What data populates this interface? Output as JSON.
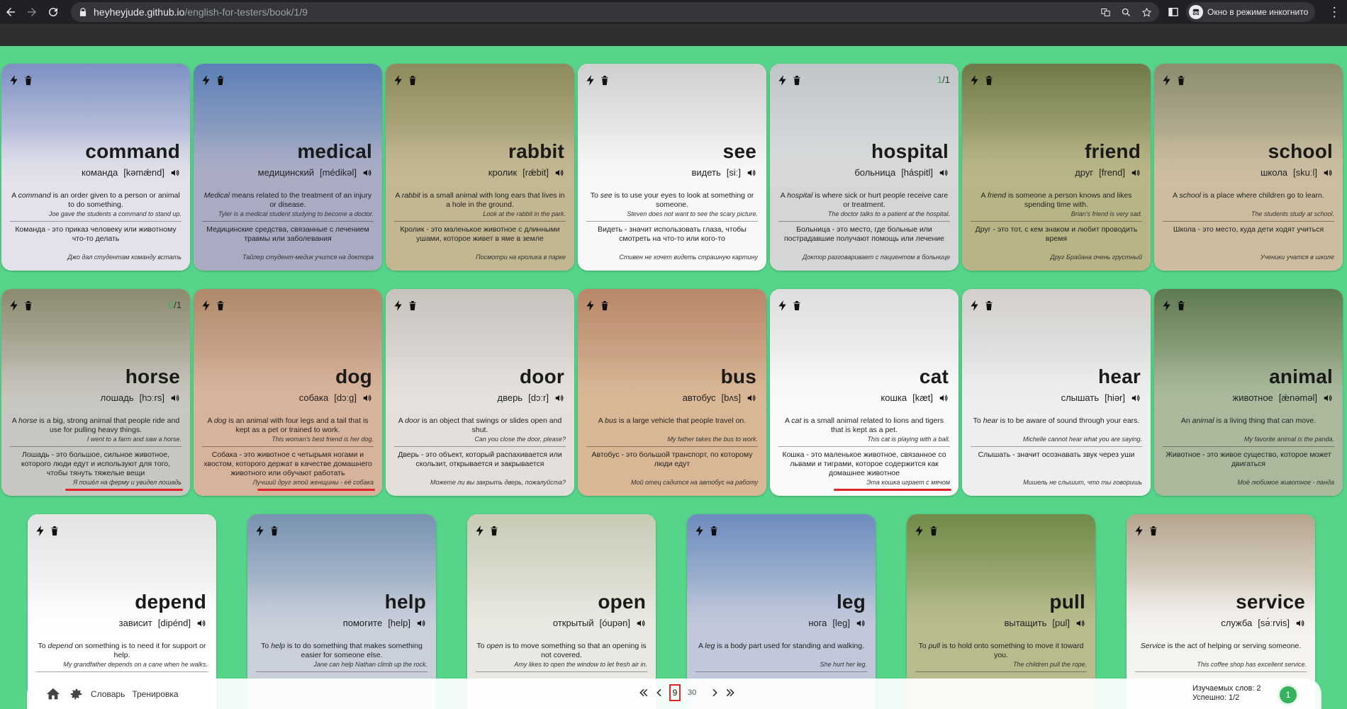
{
  "browser": {
    "host": "heyheyjude.github.io",
    "path": "/english-for-testers/book/1/9",
    "incognito_label": "Окно в режиме инкогнито"
  },
  "cards": [
    {
      "word": "command",
      "ru": "команда",
      "ipa": "[kəmǽnd]",
      "meaning_parts": [
        "A ",
        "command",
        " is an order given to a person or animal to do something."
      ],
      "example": "Joe gave the students a command to stand up.",
      "meaning_ru": "Команда - это приказ человеку или животному что-то делать",
      "example_ru": "Джо дал студентам команду встать",
      "score": "",
      "bg": "#e3e2ea",
      "photo": [
        "#7d8fc2",
        "#e8e6ee"
      ]
    },
    {
      "word": "medical",
      "ru": "медицинский",
      "ipa": "[médikəl]",
      "meaning_parts": [
        "",
        "Medical",
        " means related to the treatment of an injury or disease."
      ],
      "example": "Tyler is a medical student studying to become a doctor.",
      "meaning_ru": "Медицинские средства, связанные с лечением травмы или заболевания",
      "example_ru": "Тайлер студент-медик учится на доктора",
      "score": "",
      "bg": "#a9abc3",
      "photo": [
        "#5b7fb5",
        "#b3b4c9"
      ]
    },
    {
      "word": "rabbit",
      "ru": "кролик",
      "ipa": "[rǽbit]",
      "meaning_parts": [
        "A ",
        "rabbit",
        " is a small animal with long ears that lives in a hole in the ground."
      ],
      "example": "Look at the rabbit in the park.",
      "meaning_ru": "Кролик - это маленькое животное с длинными ушами, которое живет в яме в земле",
      "example_ru": "Посмотри на кролика в парке",
      "score": "",
      "bg": "#c3b791",
      "photo": [
        "#8d8a5b",
        "#c8bd98"
      ]
    },
    {
      "word": "see",
      "ru": "видеть",
      "ipa": "[siː]",
      "meaning_parts": [
        "To ",
        "see",
        " is to use your eyes to look at something or someone."
      ],
      "example": "Steven does not want to see the scary picture.",
      "meaning_ru": "Видеть - значит использовать глаза, чтобы смотреть на что-то или кого-то",
      "example_ru": "Стивен не хочет видеть страшную картину",
      "score": "",
      "bg": "#f8f8f8",
      "photo": [
        "#cfcfcf",
        "#fafafa"
      ]
    },
    {
      "word": "hospital",
      "ru": "больница",
      "ipa": "[háspitl]",
      "meaning_parts": [
        "A ",
        "hospital",
        " is where sick or hurt people receive care or treatment."
      ],
      "example": "The doctor talks to a patient at the hospital.",
      "meaning_ru": "Больница - это место, где больные или пострадавшие получают помощь или лечение",
      "example_ru": "Доктор разговаривает с пациентом в больнице",
      "score": "1/1",
      "bg": "#d3d5d6",
      "photo": [
        "#bfc5c8",
        "#dfe1e2"
      ]
    },
    {
      "word": "friend",
      "ru": "друг",
      "ipa": "[frend]",
      "meaning_parts": [
        "A ",
        "friend",
        " is someone a person knows and likes spending time with."
      ],
      "example": "Brian's friend is very sad.",
      "meaning_ru": "Друг - это тот, с кем знаком и любит проводить время",
      "example_ru": "Друг Брайана очень грустный",
      "score": "",
      "bg": "#b9b486",
      "photo": [
        "#6f7a48",
        "#c2bd8f"
      ]
    },
    {
      "word": "school",
      "ru": "школа",
      "ipa": "[skuːl]",
      "meaning_parts": [
        "A ",
        "school",
        " is a place where children go to learn."
      ],
      "example": "The students study at school.",
      "meaning_ru": "Школа - это место, куда дети ходят учиться",
      "example_ru": "Ученики учатся в школе",
      "score": "",
      "bg": "#ccbca0",
      "photo": [
        "#8a8c70",
        "#d3c4a8"
      ]
    },
    {
      "word": "horse",
      "ru": "лошадь",
      "ipa": "[hɔːrs]",
      "meaning_parts": [
        "A ",
        "horse",
        " is a big, strong animal that people ride and use for pulling heavy things."
      ],
      "example": "I went to a farm and saw a horse.",
      "meaning_ru": "Лошадь - это большое, сильное животное, которого люди едут и используют для того, чтобы тянуть тяжелые вещи",
      "example_ru": "Я пошёл на ферму и увидел лошадь",
      "score": "0/1",
      "bg": "#c7c6c0",
      "photo": [
        "#8c8a6f",
        "#cfcdc6"
      ],
      "underline": true
    },
    {
      "word": "dog",
      "ru": "собака",
      "ipa": "[dɔːg]",
      "meaning_parts": [
        "A ",
        "dog",
        " is an animal with four legs and a tail that is kept as a pet or trained to work."
      ],
      "example": "This woman's best friend is her dog.",
      "meaning_ru": "Собака - это животное с четырьмя ногами и хвостом, которого держат в качестве домашнего животного или обучают работать",
      "example_ru": "Лучший друг этой женщины - её собака",
      "score": "",
      "bg": "#d8b39c",
      "photo": [
        "#b0896a",
        "#dcb9a2"
      ],
      "underline": true
    },
    {
      "word": "door",
      "ru": "дверь",
      "ipa": "[dɔːr]",
      "meaning_parts": [
        "A ",
        "door",
        " is an object that swings or slides open and shut."
      ],
      "example": "Can you close the door, please?",
      "meaning_ru": "Дверь - это объект, который распахивается или скользит, открывается и закрывается",
      "example_ru": "Можете ли вы закрыть дверь, пожалуйста?",
      "score": "",
      "bg": "#e3e0dc",
      "photo": [
        "#c6c2bc",
        "#e8e5e0"
      ]
    },
    {
      "word": "bus",
      "ru": "автобус",
      "ipa": "[bʌs]",
      "meaning_parts": [
        "A ",
        "bus",
        " is a large vehicle that people travel on."
      ],
      "example": "My father takes the bus to work.",
      "meaning_ru": "Автобус - это большой транспорт, по которому люди едут",
      "example_ru": "Мой отец садится на автобус на работу",
      "score": "",
      "bg": "#d9b795",
      "photo": [
        "#b8876a",
        "#dcbc9b"
      ]
    },
    {
      "word": "cat",
      "ru": "кошка",
      "ipa": "[kæt]",
      "meaning_parts": [
        "A ",
        "cat",
        " is a small animal related to lions and tigers that is kept as a pet."
      ],
      "example": "This cat is playing with a ball.",
      "meaning_ru": "Кошка - это маленькое животное, связанное со львами и тиграми, которое содержится как домашнее животное",
      "example_ru": "Эта кошка играет с мячом",
      "score": "",
      "bg": "#fafafa",
      "photo": [
        "#dedede",
        "#fbfbfb"
      ],
      "underline": true
    },
    {
      "word": "hear",
      "ru": "слышать",
      "ipa": "[hiər]",
      "meaning_parts": [
        "To ",
        "hear",
        " is to be aware of sound through your ears."
      ],
      "example": "Michelle cannot hear what you are saying.",
      "meaning_ru": "Слышать - значит осознавать звук через уши",
      "example_ru": "Мишель не слышит, что ты говоришь",
      "score": "",
      "bg": "#eeeeee",
      "photo": [
        "#d2cfcc",
        "#f0f0f0"
      ]
    },
    {
      "word": "animal",
      "ru": "животное",
      "ipa": "[ǽnəməl]",
      "meaning_parts": [
        "An ",
        "animal",
        " is a living thing that can move."
      ],
      "example": "My favorite animal is the panda.",
      "meaning_ru": "Животное - это живое существо, которое может двигаться",
      "example_ru": "Моё любимое животное - панда",
      "score": "",
      "bg": "#aab99c",
      "photo": [
        "#5f7a52",
        "#b2c1a4"
      ]
    },
    {
      "word": "depend",
      "ru": "зависит",
      "ipa": "[dipénd]",
      "meaning_parts": [
        "To ",
        "depend",
        " on something is to need it for support or help."
      ],
      "example": "My grandfather depends on a cane when he walks.",
      "meaning_ru": "",
      "example_ru": "",
      "score": "",
      "bg": "#ffffff",
      "photo": [
        "#e3e3e3",
        "#ffffff"
      ]
    },
    {
      "word": "help",
      "ru": "помогите",
      "ipa": "[help]",
      "meaning_parts": [
        "To ",
        "help",
        " is to do something that makes something easier for someone else."
      ],
      "example": "Jane can help Nathan climb up the rock.",
      "meaning_ru": "",
      "example_ru": "",
      "score": "",
      "bg": "#c9d0db",
      "photo": [
        "#7892b0",
        "#ccd3de"
      ]
    },
    {
      "word": "open",
      "ru": "открытый",
      "ipa": "[óupən]",
      "meaning_parts": [
        "To ",
        "open",
        " is to move something so that an opening is not covered."
      ],
      "example": "Amy likes to open the window to let fresh air in.",
      "meaning_ru": "",
      "example_ru": "",
      "score": "",
      "bg": "#e9e8e2",
      "photo": [
        "#c7cbb5",
        "#ebeae4"
      ]
    },
    {
      "word": "leg",
      "ru": "нога",
      "ipa": "[leg]",
      "meaning_parts": [
        "A ",
        "leg",
        " is a body part used for standing and walking."
      ],
      "example": "She hurt her leg.",
      "meaning_ru": "",
      "example_ru": "",
      "score": "",
      "bg": "#c1c8d9",
      "photo": [
        "#6d8cbd",
        "#c6cdde"
      ]
    },
    {
      "word": "pull",
      "ru": "вытащить",
      "ipa": "[pul]",
      "meaning_parts": [
        "To ",
        "pull",
        " is to hold onto something to move it toward you."
      ],
      "example": "The children pull the rope.",
      "meaning_ru": "",
      "example_ru": "",
      "score": "",
      "bg": "#b9bb8c",
      "photo": [
        "#6f8a48",
        "#c0c293"
      ]
    },
    {
      "word": "service",
      "ru": "служба",
      "ipa": "[sə́ːrvis]",
      "meaning_parts": [
        "",
        "Service",
        " is the act of helping or serving someone."
      ],
      "example": "This coffee shop has excellent service.",
      "meaning_ru": "",
      "example_ru": "",
      "score": "",
      "bg": "#f5f3f0",
      "photo": [
        "#b5a58e",
        "#f7f5f2"
      ]
    }
  ],
  "pager": {
    "dictionary_link": "Словарь",
    "training_link": "Тренировка",
    "current_page": "9",
    "total_pages": "30",
    "studied_words": "Изучаемых слов: 2",
    "success": "Успешно: 1/2",
    "level": "1"
  }
}
